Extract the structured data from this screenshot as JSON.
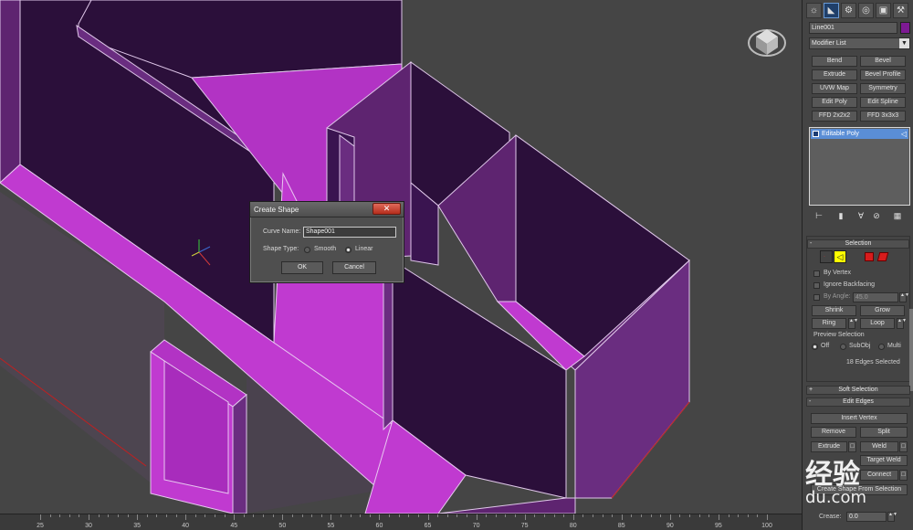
{
  "dialog": {
    "title": "Create Shape",
    "close_label": "✕",
    "curve_name_label": "Curve Name:",
    "curve_name_value": "Shape001",
    "shape_type_label": "Shape Type:",
    "smooth_label": "Smooth",
    "linear_label": "Linear",
    "selected_type": "Linear",
    "ok_label": "OK",
    "cancel_label": "Cancel"
  },
  "command_panel": {
    "tabs": [
      {
        "icon": "sun-icon",
        "glyph": "☼"
      },
      {
        "icon": "modify-icon",
        "glyph": "◣"
      },
      {
        "icon": "hierarchy-icon",
        "glyph": "⚙"
      },
      {
        "icon": "motion-icon",
        "glyph": "◎"
      },
      {
        "icon": "display-icon",
        "glyph": "▣"
      },
      {
        "icon": "utilities-icon",
        "glyph": "⚒"
      }
    ],
    "object_name": "Line001",
    "object_color": "#7d1a93",
    "modifier_list": "Modifier List",
    "modifier_buttons": [
      "Bend",
      "Bevel",
      "Extrude",
      "Bevel Profile",
      "UVW Map",
      "Symmetry",
      "Edit Poly",
      "Edit Spline",
      "FFD 2x2x2",
      "FFD 3x3x3"
    ],
    "stack_item": "Editable Poly",
    "stack_tools": [
      "pin-stack-icon",
      "show-result-icon",
      "make-unique-icon",
      "remove-modifier-icon",
      "configure-icon"
    ],
    "selection": {
      "title": "Selection",
      "by_vertex": "By Vertex",
      "ignore_backfacing": "Ignore Backfacing",
      "by_angle": "By Angle:",
      "angle_value": "45.0",
      "shrink": "Shrink",
      "grow": "Grow",
      "ring": "Ring",
      "loop": "Loop",
      "preview_title": "Preview Selection",
      "preview_off": "Off",
      "preview_subobj": "SubObj",
      "preview_multi": "Multi",
      "status": "18 Edges Selected"
    },
    "soft_selection": "Soft Selection",
    "edit_edges": {
      "title": "Edit Edges",
      "insert_vertex": "Insert Vertex",
      "remove": "Remove",
      "split": "Split",
      "extrude": "Extrude",
      "weld": "Weld",
      "target_weld": "Target Weld",
      "connect": "Connect",
      "create_shape": "Create Shape From Selection",
      "crease_label": "Crease:",
      "crease_value": "0.0"
    }
  },
  "timeline": {
    "ticks": [
      "25",
      "30",
      "35",
      "40",
      "45",
      "50",
      "55",
      "60",
      "65",
      "70",
      "75",
      "80",
      "85",
      "90",
      "95",
      "100"
    ]
  },
  "watermark": {
    "line1": "经验",
    "line2": "du.com"
  },
  "colors": {
    "wall_top": "#c03ad0",
    "wall_dark": "#2b0f3a",
    "wall_side": "#5e2470",
    "viewport_bg": "#454545"
  }
}
